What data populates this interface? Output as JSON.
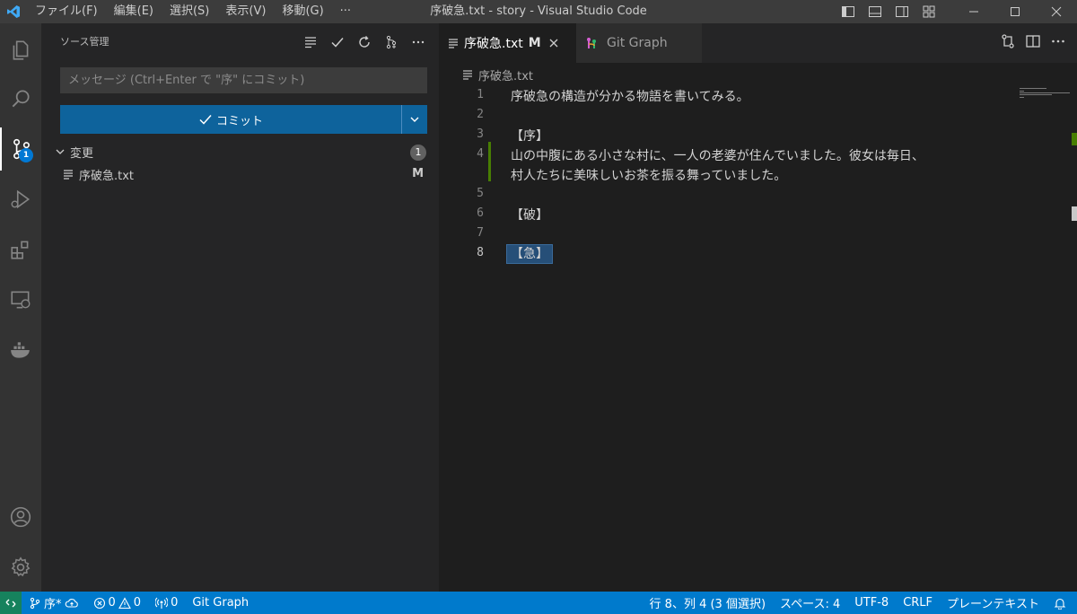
{
  "titlebar": {
    "menu": [
      "ファイル(F)",
      "編集(E)",
      "選択(S)",
      "表示(V)",
      "移動(G)",
      "···"
    ],
    "title": "序破急.txt - story - Visual Studio Code"
  },
  "activity_bar": {
    "scm_badge": "1"
  },
  "sidebar": {
    "title": "ソース管理",
    "commit_placeholder": "メッセージ (Ctrl+Enter で \"序\" にコミット)",
    "commit_label": "コミット",
    "changes_label": "変更",
    "changes_count": "1",
    "file_name": "序破急.txt",
    "file_status": "M"
  },
  "tabs": [
    {
      "label": "序破急.txt",
      "modified": "M"
    },
    {
      "label": "Git Graph"
    }
  ],
  "breadcrumb": "序破急.txt",
  "editor": {
    "lines": [
      {
        "num": "1",
        "text": "序破急の構造が分かる物語を書いてみる。"
      },
      {
        "num": "2",
        "text": ""
      },
      {
        "num": "3",
        "text": "【序】"
      },
      {
        "num": "4",
        "text": "山の中腹にある小さな村に、一人の老婆が住んでいました。彼女は毎日、"
      },
      {
        "num": "",
        "text": "村人たちに美味しいお茶を振る舞っていました。"
      },
      {
        "num": "5",
        "text": ""
      },
      {
        "num": "6",
        "text": "【破】"
      },
      {
        "num": "7",
        "text": ""
      },
      {
        "num": "8",
        "text": "【急】"
      }
    ]
  },
  "statusbar": {
    "branch": "序*",
    "errors": "0",
    "warnings": "0",
    "ports": "0",
    "git_graph": "Git Graph",
    "position": "行 8、列 4 (3 個選択)",
    "spaces": "スペース: 4",
    "encoding": "UTF-8",
    "eol": "CRLF",
    "language": "プレーンテキスト"
  },
  "colors": {
    "accent": "#007acc",
    "button": "#0e639c",
    "added_gutter": "#487e02"
  }
}
